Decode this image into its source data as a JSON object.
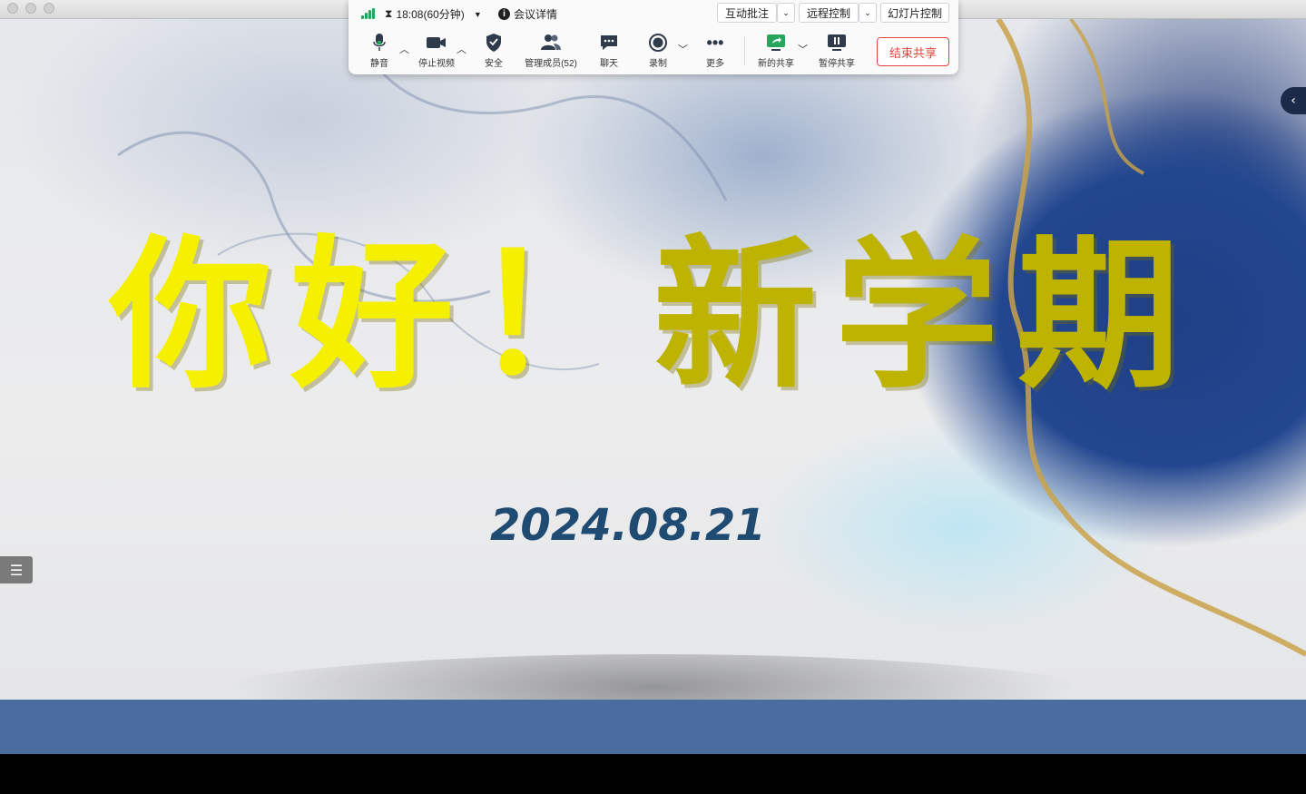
{
  "toolbar_top": {
    "timer": "18:08(60分钟)",
    "meeting_details": "会议详情",
    "annotate": "互动批注",
    "remote_control": "远程控制",
    "slide_control": "幻灯片控制"
  },
  "toolbar_tools": {
    "mute": "静音",
    "stop_video": "停止视频",
    "security": "安全",
    "manage_members": "管理成员(52)",
    "chat": "聊天",
    "record": "录制",
    "more": "更多",
    "new_share": "新的共享",
    "pause_share": "暂停共享",
    "end_share": "结束共享"
  },
  "slide": {
    "headline_part1": "你好！",
    "headline_part2": "新学期",
    "date": "2024.08.21"
  },
  "colors": {
    "signal": "#26a65b",
    "end_share": "#e0463a",
    "headline": "#e8e400",
    "date": "#1f4a72",
    "footer_band": "#4a6c9e"
  }
}
